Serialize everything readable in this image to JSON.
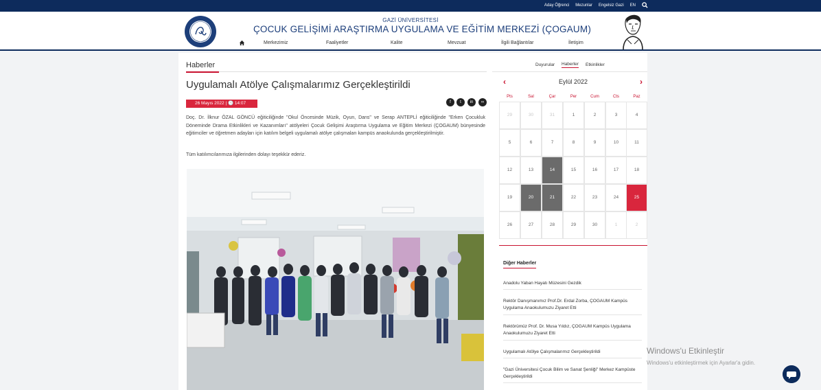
{
  "topbar": {
    "links": [
      "Aday Öğrenci",
      "Mezunlar",
      "Engelsiz Gazi",
      "EN"
    ],
    "search_icon": "search-icon"
  },
  "header": {
    "subtitle": "GAZİ ÜNİVERSİTESİ",
    "title": "ÇOCUK GELİŞİMİ ARAŞTIRMA UYGULAMA VE EĞİTİM MERKEZİ (ÇOGAUM)",
    "nav": [
      "Merkezimiz",
      "Faaliyetler",
      "Kalite",
      "Mevzuat",
      "İlgili Bağlantılar",
      "İletişim"
    ]
  },
  "main": {
    "section_title": "Haberler",
    "article_title": "Uygulamalı Atölye Çalışmalarımız Gerçekleştirildi",
    "date": "26 Mayıs 2022 | 🕓 14:07",
    "share_icons": [
      "facebook-icon",
      "twitter-icon",
      "linkedin-icon",
      "link-icon"
    ],
    "body": "Doç. Dr. İlknur ÖZAL GÖNCÜ eğiticiliğinde \"Okul Öncesinde Müzik, Oyun, Dans\" ve Serap ANTEPLİ eğiticiliğinde \"Erken Çocukluk Döneminde Drama Etkinlikleri ve Kazanımları\" atölyeleri Çocuk Gelişimi Araştırma Uygulama ve Eğitim Merkezi (ÇOGAUM) bünyesinde eğitimciler ve öğretmen adayları için katılım belgeli uygulamalı atölye çalışmaları kampüs anaokulunda gerçekleştirilmiştir.",
    "thanks": "Tüm katılımcılarımıza ilgilerinden dolayı teşekkür ederiz."
  },
  "sidebar": {
    "tabs": [
      "Duyurular",
      "Haberler",
      "Etkinlikler"
    ],
    "calendar": {
      "month": "Eylül 2022",
      "prev": "‹",
      "next": "›",
      "weekdays": [
        "Pts",
        "Sal",
        "Çar",
        "Per",
        "Cum",
        "Cts",
        "Paz"
      ],
      "weeks": [
        [
          "29",
          "30",
          "31",
          "1",
          "2",
          "3",
          "4"
        ],
        [
          "5",
          "6",
          "7",
          "8",
          "9",
          "10",
          "11"
        ],
        [
          "12",
          "13",
          "14",
          "15",
          "16",
          "17",
          "18"
        ],
        [
          "19",
          "20",
          "21",
          "22",
          "23",
          "24",
          "25"
        ],
        [
          "26",
          "27",
          "28",
          "29",
          "30",
          "1",
          "2"
        ]
      ]
    },
    "other_news_title": "Diğer Haberler",
    "other_news": [
      "Anadolu Yaban Hayatı Müzesini Gezdik",
      "Rektör Danışmanımız Prof.Dr. Erdal Zorba, ÇOGAUM Kampüs Uygulama Anaokulumuzu Ziyaret Etti",
      "Rektörümüz Prof. Dr. Musa Yıldız, ÇOGAUM Kampüs Uygulama Anaokulumuzu Ziyaret Etti",
      "Uygulamalı Atölye Çalışmalarımız Gerçekleştirildi",
      "\"Gazi Üniversitesi Çocuk Bilim ve Sanat Şenliği\" Merkez Kampüste Gerçekleştirildi"
    ]
  },
  "watermark": {
    "line1": "Windows'u Etkinleştir",
    "line2": "Windows'u etkinleştirmek için Ayarlar'a gidin."
  },
  "colors": {
    "navy": "#0d2b5c",
    "accent_red": "#d9263d",
    "highlight_gray": "#6b6b6b"
  }
}
